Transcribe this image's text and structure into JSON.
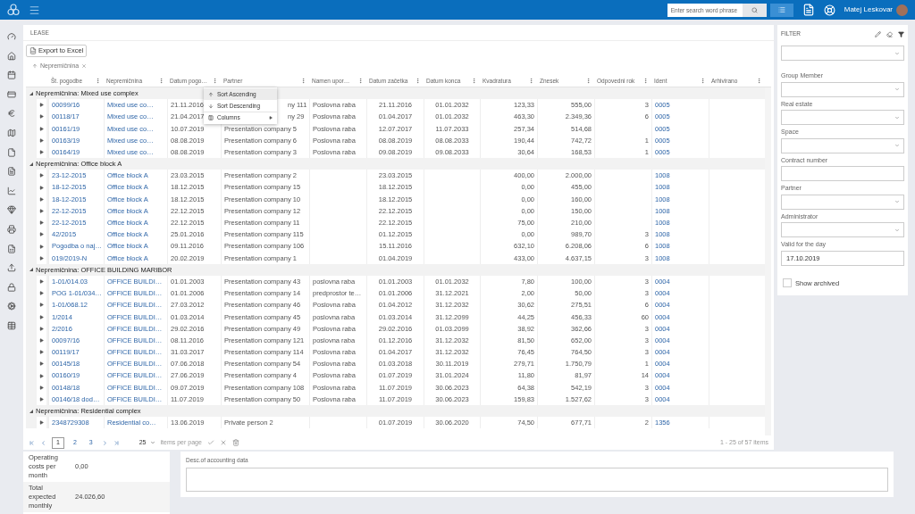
{
  "top_bar": {
    "search": {
      "placeholder": "Enter search word phrase"
    },
    "user": "Matej Leskovar"
  },
  "lease": {
    "title": "LEASE",
    "export_button": "Export to Excel",
    "group_chip": "Nepremičnina",
    "columns": [
      "Št. pogodbe",
      "Nepremičnina",
      "Datum pogo…",
      "Partner",
      "Namen upor…",
      "Datum začetka",
      "Datum konca",
      "Kvadratura",
      "Znesek",
      "Odpovedni rok",
      "Ident",
      "Arhivirano"
    ],
    "groups": [
      {
        "title": "Nepremičnina: Mixed use complex",
        "expanded": true,
        "rows": [
          [
            "00099/16",
            "Mixed use co…",
            "21.11.2016",
            "ny 111",
            "Poslovna raba",
            "21.11.2016",
            "01.01.2032",
            "123,33",
            "555,00",
            "3",
            "0005"
          ],
          [
            "00118/17",
            "Mixed use co…",
            "21.04.2017",
            "ny 29",
            "Poslovna raba",
            "01.04.2017",
            "01.01.2032",
            "463,30",
            "2.349,36",
            "6",
            "0005"
          ],
          [
            "00161/19",
            "Mixed use co…",
            "10.07.2019",
            "Presentation company 5",
            "Poslovna raba",
            "12.07.2017",
            "11.07.2033",
            "257,34",
            "514,68",
            null,
            "0005"
          ],
          [
            "00163/19",
            "Mixed use co…",
            "08.08.2019",
            "Presentation company 6",
            "Poslovna raba",
            "08.08.2019",
            "08.08.2033",
            "190,44",
            "742,72",
            "1",
            "0005"
          ],
          [
            "00164/19",
            "Mixed use co…",
            "08.08.2019",
            "Presentation company 3",
            "Poslovna raba",
            "09.08.2019",
            "09.08.2033",
            "30,64",
            "168,53",
            "1",
            "0005"
          ]
        ]
      },
      {
        "title": "Nepremičnina: Office block A",
        "expanded": true,
        "rows": [
          [
            "23-12-2015",
            "Office block A",
            "23.03.2015",
            "Presentation company 2",
            null,
            "23.03.2015",
            null,
            "400,00",
            "2.000,00",
            null,
            "1008"
          ],
          [
            "18-12-2015",
            "Office block A",
            "18.12.2015",
            "Presentation company 15",
            null,
            "18.12.2015",
            null,
            "0,00",
            "455,00",
            null,
            "1008"
          ],
          [
            "18-12-2015",
            "Office block A",
            "18.12.2015",
            "Presentation company 10",
            null,
            "18.12.2015",
            null,
            "0,00",
            "160,00",
            null,
            "1008"
          ],
          [
            "22-12-2015",
            "Office block A",
            "22.12.2015",
            "Presentation company 12",
            null,
            "22.12.2015",
            null,
            "0,00",
            "150,00",
            null,
            "1008"
          ],
          [
            "22-12-2015",
            "Office block A",
            "22.12.2015",
            "Presentation company 11",
            null,
            "22.12.2015",
            null,
            "75,00",
            "210,00",
            null,
            "1008"
          ],
          [
            "42/2015",
            "Office block A",
            "25.01.2016",
            "Presentation company 115",
            null,
            "01.12.2015",
            null,
            "0,00",
            "989,70",
            "3",
            "1008"
          ],
          [
            "Pogodba o naj…",
            "Office block A",
            "09.11.2016",
            "Presentation company 106",
            null,
            "15.11.2016",
            null,
            "632,10",
            "6.208,06",
            "6",
            "1008"
          ],
          [
            "019/2019-N",
            "Office block A",
            "20.02.2019",
            "Presentation company 1",
            null,
            "01.04.2019",
            null,
            "433,00",
            "4.637,15",
            "3",
            "1008"
          ]
        ]
      },
      {
        "title": "Nepremičnina: OFFICE BUILDING MARIBOR",
        "expanded": true,
        "rows": [
          [
            "1-01/014.03",
            "OFFICE BUILDI…",
            "01.01.2003",
            "Presentation company 43",
            "poslovna raba",
            "01.01.2003",
            "01.01.2032",
            "7,80",
            "100,00",
            "3",
            "0004"
          ],
          [
            "POG 1-01/034…",
            "OFFICE BUILDI…",
            "01.01.2006",
            "Presentation company 14",
            "predprostor te…",
            "01.01.2006",
            "31.12.2021",
            "2,00",
            "50,00",
            "3",
            "0004"
          ],
          [
            "1-01/068.12",
            "OFFICE BUILDI…",
            "27.03.2012",
            "Presentation company 46",
            "Poslovna raba",
            "01.04.2012",
            "31.12.2032",
            "30,62",
            "275,51",
            "6",
            "0004"
          ],
          [
            "1/2014",
            "OFFICE BUILDI…",
            "01.03.2014",
            "Presentation company 45",
            "poslovna raba",
            "01.03.2014",
            "31.12.2099",
            "44,25",
            "456,33",
            "60",
            "0004"
          ],
          [
            "2/2016",
            "OFFICE BUILDI…",
            "29.02.2016",
            "Presentation company 49",
            "Poslovna raba",
            "29.02.2016",
            "01.03.2099",
            "38,92",
            "362,66",
            "3",
            "0004"
          ],
          [
            "00097/16",
            "OFFICE BUILDI…",
            "08.11.2016",
            "Presentation company 121",
            "poslovna raba",
            "01.12.2016",
            "31.12.2032",
            "81,50",
            "652,00",
            "3",
            "0004"
          ],
          [
            "00119/17",
            "OFFICE BUILDI…",
            "31.03.2017",
            "Presentation company 114",
            "Poslovna raba",
            "01.04.2017",
            "31.12.2032",
            "76,45",
            "764,50",
            "3",
            "0004"
          ],
          [
            "00145/18",
            "OFFICE BUILDI…",
            "07.06.2018",
            "Presentation company 54",
            "Poslovna raba",
            "01.03.2018",
            "30.11.2019",
            "279,71",
            "1.750,79",
            "1",
            "0004"
          ],
          [
            "00160/19",
            "OFFICE BUILDI…",
            "27.06.2019",
            "Presentation company 4",
            "Poslovna raba",
            "01.07.2019",
            "31.01.2024",
            "11,80",
            "81,97",
            "14",
            "0004"
          ],
          [
            "00148/18",
            "OFFICE BUILDI…",
            "09.07.2019",
            "Presentation company 108",
            "Poslovna raba",
            "11.07.2019",
            "30.06.2023",
            "64,38",
            "542,19",
            "3",
            "0004"
          ],
          [
            "00146/18 dod…",
            "OFFICE BUILDI…",
            "11.07.2019",
            "Presentation company 50",
            "Poslovna raba",
            "11.07.2019",
            "30.06.2023",
            "159,83",
            "1.527,62",
            "3",
            "0004"
          ]
        ]
      },
      {
        "title": "Nepremičnina: Residential complex",
        "expanded": true,
        "rows": [
          [
            "2348729308",
            "Residential co…",
            "13.06.2019",
            "Private person 2",
            null,
            "01.07.2019",
            "30.06.2020",
            "74,50",
            "677,71",
            "2",
            "1356"
          ]
        ]
      }
    ],
    "column_menu": [
      {
        "kind": "sort_asc",
        "label": "Sort Ascending",
        "selected": true
      },
      {
        "kind": "sort_desc",
        "label": "Sort Descending",
        "selected": false
      },
      {
        "kind": "columns",
        "label": "Columns",
        "selected": false
      }
    ],
    "pager": {
      "pages": [
        {
          "label": "1",
          "selected": true
        },
        {
          "label": "2",
          "selected": false
        },
        {
          "label": "3",
          "selected": false
        }
      ],
      "page_size": "25",
      "page_size_label": "items per page",
      "summary": "1 - 25 of 57 items"
    }
  },
  "filter": {
    "title": "FILTER",
    "fields": [
      {
        "kind": "select"
      },
      {
        "kind": "select",
        "label": "Group Member"
      },
      {
        "kind": "select",
        "label": "Real estate"
      },
      {
        "kind": "select",
        "label": "Space"
      },
      {
        "kind": "input",
        "label": "Contract number"
      },
      {
        "kind": "select",
        "label": "Partner"
      },
      {
        "kind": "select",
        "label": "Administrator"
      },
      {
        "kind": "input",
        "label": "Valid for the day",
        "value": "17.10.2019"
      }
    ],
    "show_archived": {
      "label": "Show archived",
      "checked": false
    }
  },
  "costs": [
    {
      "label": "Operating costs per month",
      "value": "0,00"
    },
    {
      "label": "Total expected monthly",
      "value": "24.026,60"
    }
  ],
  "accounting": {
    "label": "Desc.of accounting data"
  }
}
